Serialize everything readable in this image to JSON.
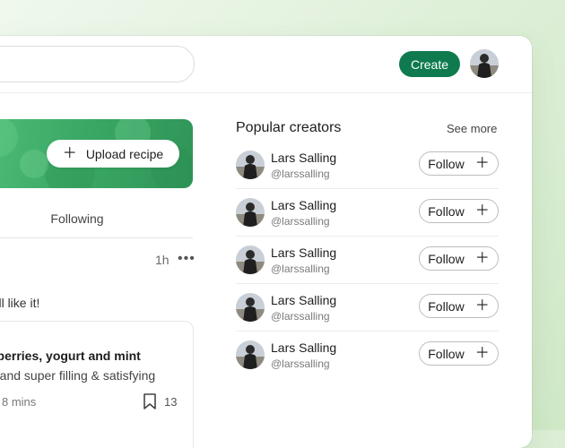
{
  "header": {
    "create_label": "Create"
  },
  "banner": {
    "upload_label": "Upload recipe"
  },
  "feed": {
    "tab_following": "Following",
    "post_time": "1h",
    "post_text": "u'll like it!",
    "recipe_title": "nberries, yogurt and mint",
    "recipe_desc": "n and super filling & satisfying",
    "recipe_time": "8 mins",
    "bookmark_count": "13"
  },
  "sidebar": {
    "title": "Popular creators",
    "see_more": "See more",
    "creators": [
      {
        "name": "Lars Salling",
        "handle": "@larssalling",
        "follow_label": "Follow"
      },
      {
        "name": "Lars Salling",
        "handle": "@larssalling",
        "follow_label": "Follow"
      },
      {
        "name": "Lars Salling",
        "handle": "@larssalling",
        "follow_label": "Follow"
      },
      {
        "name": "Lars Salling",
        "handle": "@larssalling",
        "follow_label": "Follow"
      },
      {
        "name": "Lars Salling",
        "handle": "@larssalling",
        "follow_label": "Follow"
      }
    ]
  },
  "colors": {
    "accent": "#0e7a4e",
    "banner": "#3aa865"
  },
  "icons": [
    "plus-icon",
    "more-dots-icon",
    "bookmark-icon",
    "avatar"
  ]
}
